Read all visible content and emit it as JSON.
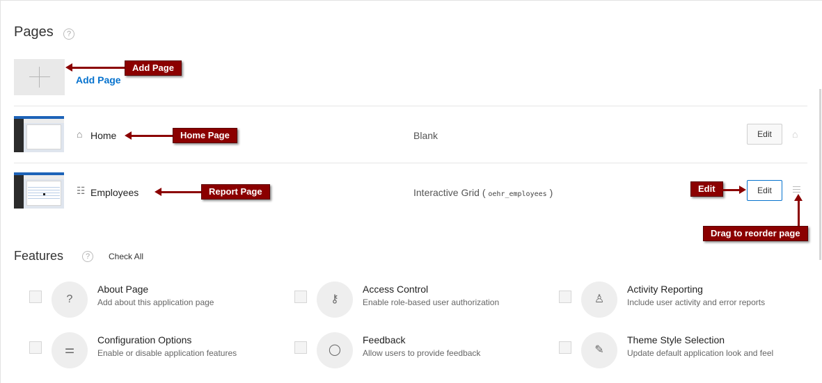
{
  "pages_section": {
    "title": "Pages",
    "help_icon": "?",
    "add_page": {
      "icon": "plus-icon",
      "label": "Add Page"
    },
    "rows": [
      {
        "icon": "home-icon",
        "icon_glyph": "⌂",
        "name": "Home",
        "type": "Blank",
        "type_code": "",
        "edit_label": "Edit",
        "trailing_icon": "home-icon"
      },
      {
        "icon": "report-icon",
        "icon_glyph": "☷",
        "name": "Employees",
        "type": "Interactive Grid (",
        "type_code": "oehr_employees",
        "type_suffix": ")",
        "edit_label": "Edit",
        "trailing_icon": "drag-handle-icon"
      }
    ]
  },
  "annotations": {
    "add_page": "Add Page",
    "home_page": "Home Page",
    "report_page": "Report Page",
    "edit": "Edit",
    "drag": "Drag to reorder page",
    "color": "#8b0000"
  },
  "features_section": {
    "title": "Features",
    "help_icon": "?",
    "check_all": "Check All",
    "items": [
      {
        "icon": "help-circle-icon",
        "glyph": "?",
        "title": "About Page",
        "description": "Add about this application page"
      },
      {
        "icon": "key-icon",
        "glyph": "⚷",
        "title": "Access Control",
        "description": "Enable role-based user authorization"
      },
      {
        "icon": "user-chart-icon",
        "glyph": "♙",
        "title": "Activity Reporting",
        "description": "Include user activity and error reports"
      },
      {
        "icon": "sliders-icon",
        "glyph": "⚌",
        "title": "Configuration Options",
        "description": "Enable or disable application features"
      },
      {
        "icon": "comment-icon",
        "glyph": "◯",
        "title": "Feedback",
        "description": "Allow users to provide feedback"
      },
      {
        "icon": "brush-icon",
        "glyph": "✎",
        "title": "Theme Style Selection",
        "description": "Update default application look and feel"
      }
    ]
  },
  "colors": {
    "link": "#0572ce",
    "accent_border": "#0572ce"
  }
}
